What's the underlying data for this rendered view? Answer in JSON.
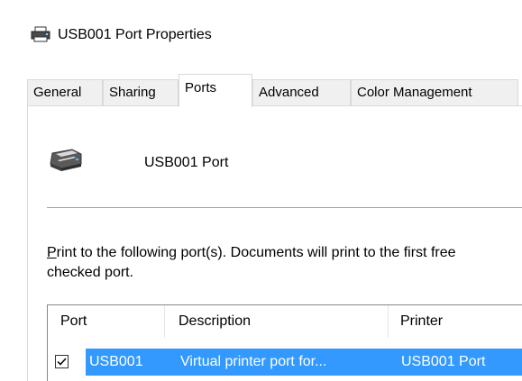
{
  "window": {
    "title": "USB001 Port Properties"
  },
  "tabs": [
    {
      "label": "General",
      "active": false
    },
    {
      "label": "Sharing",
      "active": false
    },
    {
      "label": "Ports",
      "active": true
    },
    {
      "label": "Advanced",
      "active": false
    },
    {
      "label": "Color Management",
      "active": false
    }
  ],
  "ports_tab": {
    "printer_name": "USB001 Port",
    "instructions_accel": "P",
    "instructions_rest_line1": "rint to the following port(s). Documents will print to the first free",
    "instructions_line2": "checked port.",
    "list": {
      "columns": [
        "Port",
        "Description",
        "Printer"
      ],
      "rows": [
        {
          "checked": true,
          "selected": true,
          "port": "USB001",
          "description": "Virtual printer port for...",
          "printer": "USB001 Port"
        }
      ]
    }
  },
  "colors": {
    "selection": "#3399ff",
    "tab_border": "#d9d9d9",
    "inactive_tab": "#f0f0f0"
  },
  "icons": {
    "title_icon": "printer-icon",
    "printer_icon": "printer-icon",
    "checkbox_icon": "checkmark-icon"
  }
}
